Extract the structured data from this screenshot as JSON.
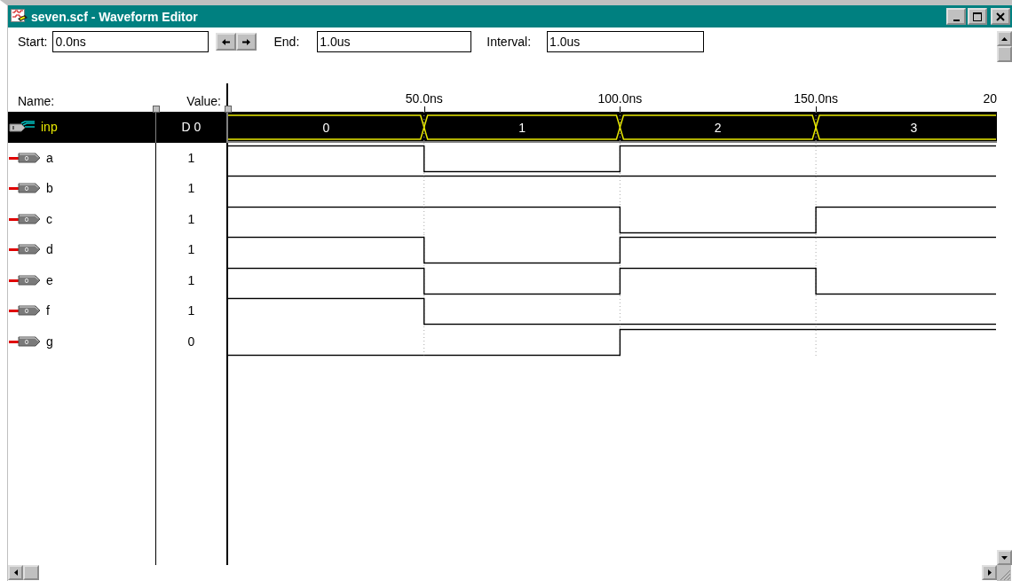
{
  "window": {
    "title": "seven.scf - Waveform Editor"
  },
  "toolbar": {
    "start": {
      "label": "Start:",
      "value": "0.0ns"
    },
    "end": {
      "label": "End:",
      "value": "1.0us"
    },
    "interval": {
      "label": "Interval:",
      "value": "1.0us"
    }
  },
  "columns": {
    "name": "Name:",
    "value": "Value:"
  },
  "ruler": {
    "ticks": [
      "50.0ns",
      "100.0ns",
      "150.0ns",
      "20"
    ]
  },
  "signals": [
    {
      "kind": "input",
      "name": "inp",
      "value": "D 0",
      "selected": true,
      "segments": [
        "0",
        "1",
        "2",
        "3"
      ]
    },
    {
      "kind": "output",
      "name": "a",
      "value": "1",
      "selected": false,
      "high": [
        true,
        false,
        true,
        true
      ]
    },
    {
      "kind": "output",
      "name": "b",
      "value": "1",
      "selected": false,
      "high": [
        true,
        true,
        true,
        true
      ]
    },
    {
      "kind": "output",
      "name": "c",
      "value": "1",
      "selected": false,
      "high": [
        true,
        true,
        false,
        true
      ]
    },
    {
      "kind": "output",
      "name": "d",
      "value": "1",
      "selected": false,
      "high": [
        true,
        false,
        true,
        true
      ]
    },
    {
      "kind": "output",
      "name": "e",
      "value": "1",
      "selected": false,
      "high": [
        true,
        false,
        true,
        false
      ]
    },
    {
      "kind": "output",
      "name": "f",
      "value": "1",
      "selected": false,
      "high": [
        true,
        false,
        false,
        false
      ]
    },
    {
      "kind": "output",
      "name": "g",
      "value": "0",
      "selected": false,
      "high": [
        false,
        false,
        true,
        true
      ]
    }
  ]
}
